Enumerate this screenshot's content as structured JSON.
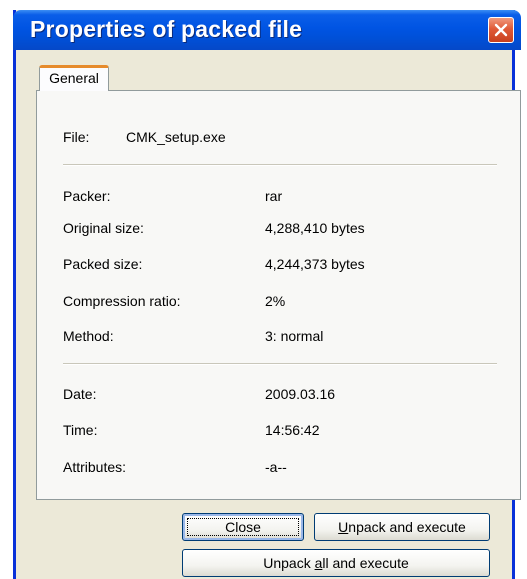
{
  "window": {
    "title": "Properties of packed file"
  },
  "tabs": [
    {
      "label": "General"
    }
  ],
  "file": {
    "label": "File:",
    "value": "CMK_setup.exe"
  },
  "details": [
    {
      "label": "Packer:",
      "value": "rar"
    },
    {
      "label": "Original size:",
      "value": "4,288,410 bytes"
    },
    {
      "label": "Packed size:",
      "value": "4,244,373 bytes"
    },
    {
      "label": "Compression ratio:",
      "value": "2%"
    },
    {
      "label": "Method:",
      "value": "3: normal"
    }
  ],
  "stamps": [
    {
      "label": "Date:",
      "value": "2009.03.16"
    },
    {
      "label": "Time:",
      "value": "14:56:42"
    },
    {
      "label": "Attributes:",
      "value": "-a--"
    }
  ],
  "buttons": {
    "close": "Close",
    "unpack_exec": {
      "accel": "U",
      "rest": "npack and execute"
    },
    "unpack_all_exec": {
      "pre": "Unpack ",
      "accel": "a",
      "rest": "ll and execute"
    }
  },
  "icons": {
    "close": "close-x-icon"
  }
}
